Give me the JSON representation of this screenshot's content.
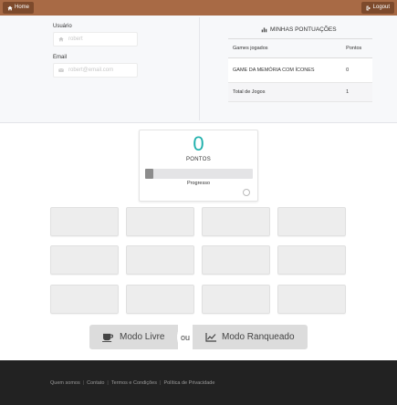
{
  "topbar": {
    "home_label": "Home",
    "logout_label": "Logout"
  },
  "profile": {
    "username_label": "Usuário",
    "username_value": "robert",
    "email_label": "Email",
    "email_value": "robert@email.com"
  },
  "scores": {
    "title": "MINHAS PONTUAÇÕES",
    "headers": [
      "Games jogados",
      "Pontos"
    ],
    "rows": [
      {
        "game": "GAME DA MEMÓRIA COM ÍCONES",
        "points": "0"
      },
      {
        "game": "Total de Jogos",
        "points": "1"
      }
    ]
  },
  "game": {
    "score_value": "0",
    "score_label": "PONTOS",
    "progress_label": "Progresso",
    "progress_fraction": 0.08
  },
  "modes": {
    "free_label": "Modo Livre",
    "or_label": "ou",
    "ranked_label": "Modo Ranqueado"
  },
  "footer": {
    "links": [
      "Quem somos",
      "Contato",
      "Termos e Condições",
      "Política de Privacidade"
    ]
  },
  "colors": {
    "topbar": "#a86a45",
    "accent": "#1fb0ac",
    "footer": "#222222"
  }
}
